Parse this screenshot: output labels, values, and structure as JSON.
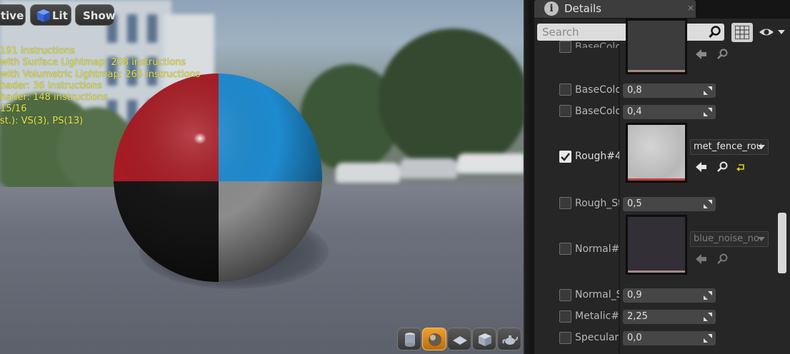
{
  "viewport": {
    "buttons": {
      "perspective": "tive",
      "lit": "Lit",
      "show": "Show"
    },
    "stats": [
      " 191 instructions",
      "with Surface Lightmap: 208 instructions",
      "with Volumetric Lightmap: 265 instructions",
      "hader: 36 instructions",
      "hader: 148 instructions",
      "15/16",
      "st.): VS(3), PS(13)"
    ],
    "stats_color": "#e6e63c",
    "sphere_quadrants": {
      "top_left": "#a81b24",
      "top_right": "#1e8bd0",
      "bottom_left": "#151515",
      "bottom_right": "#8c8c8c"
    },
    "preview_tools": [
      {
        "icon": "cylinder-icon",
        "active": false
      },
      {
        "icon": "sphere-icon",
        "active": true
      },
      {
        "icon": "plane-icon",
        "active": false
      },
      {
        "icon": "cube-icon",
        "active": false
      },
      {
        "icon": "teapot-icon",
        "active": false
      }
    ]
  },
  "details": {
    "tab_title": "Details",
    "tab_close": "×",
    "search_placeholder": "Search",
    "properties": [
      {
        "label": "BaseColo",
        "type": "texture-partial",
        "checked": false
      },
      {
        "label": "BaseColo",
        "type": "number",
        "value": "0,8",
        "checked": false
      },
      {
        "label": "BaseColo",
        "type": "number",
        "value": "0,4",
        "checked": false
      },
      {
        "label": "Rough#4",
        "type": "texture",
        "asset": "met_fence_rou",
        "checked": true
      },
      {
        "label": "Rough_St",
        "type": "number",
        "value": "0,5",
        "checked": false
      },
      {
        "label": "Normal#4",
        "type": "texture",
        "asset": "blue_noise_no",
        "checked": false
      },
      {
        "label": "Normal_S",
        "type": "number",
        "value": "0,9",
        "checked": false
      },
      {
        "label": "Metalic#4",
        "type": "number",
        "value": "2,25",
        "checked": false
      },
      {
        "label": "Specular",
        "type": "number",
        "value": "0,0",
        "checked": false
      }
    ]
  }
}
